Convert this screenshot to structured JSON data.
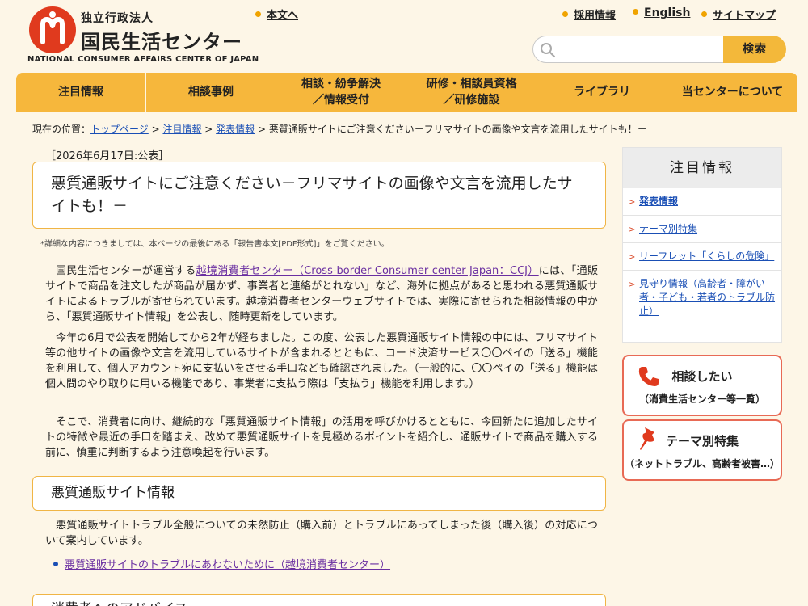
{
  "header": {
    "logo_sub": "独立行政法人",
    "logo_main": "国民生活センター",
    "logo_en": "NATIONAL CONSUMER AFFAIRS CENTER OF JAPAN",
    "links": {
      "honbun": "本文へ",
      "saiyo": "採用情報",
      "english": "English",
      "sitemap": "サイトマップ"
    },
    "search": {
      "placeholder": "",
      "button": "検索"
    }
  },
  "nav": {
    "items": [
      {
        "line1": "注目情報",
        "line2": ""
      },
      {
        "line1": "相談事例",
        "line2": ""
      },
      {
        "line1": "相談・紛争解決",
        "line2": "／情報受付"
      },
      {
        "line1": "研修・相談員資格",
        "line2": "／研修施設"
      },
      {
        "line1": "ライブラリ",
        "line2": ""
      },
      {
        "line1": "当センターについて",
        "line2": ""
      }
    ]
  },
  "breadcrumb": {
    "prefix": "現在の位置：",
    "links": [
      "トップページ",
      "注目情報",
      "発表情報"
    ],
    "sep": " > ",
    "current": "悪質通販サイトにご注意ください－フリマサイトの画像や文言を流用したサイトも！－"
  },
  "article": {
    "date": "［2026年6月17日:公表］",
    "title": "悪質通販サイトにご注意ください－フリマサイトの画像や文言を流用したサイトも！－",
    "note": "*詳細な内容につきましては、本ページの最後にある「報告書本文[PDF形式]」をご覧ください。",
    "p1_before": "国民生活センターが運営する",
    "p1_link": "越境消費者センター（Cross-border Consumer center Japan：CCJ）",
    "p1_after": "には、「通販サイトで商品を注文したが商品が届かず、事業者と連絡がとれない」など、海外に拠点があると思われる悪質通販サイトによるトラブルが寄せられています。越境消費者センターウェブサイトでは、実際に寄せられた相談情報の中から、「悪質通販サイト情報」を公表し、随時更新をしています。",
    "p2": "今年の6月で公表を開始してから2年が経ちました。この度、公表した悪質通販サイト情報の中には、フリマサイト等の他サイトの画像や文言を流用しているサイトが含まれるとともに、コード決済サービス〇〇ペイの「送る」機能を利用して、個人アカウント宛に支払いをさせる手口なども確認されました。（一般的に、〇〇ペイの「送る」機能は個人間のやり取りに用いる機能であり、事業者に支払う際は「支払う」機能を利用します。）",
    "p3": "そこで、消費者に向け、継続的な「悪質通販サイト情報」の活用を呼びかけるとともに、今回新たに追加したサイトの特徴や最近の手口を踏まえ、改めて悪質通販サイトを見極めるポイントを紹介し、通販サイトで商品を購入する前に、慎重に判断するよう注意喚起を行います。",
    "section1_title": "悪質通販サイト情報",
    "p4": "悪質通販サイトトラブル全般についての未然防止（購入前）とトラブルにあってしまった後（購入後）の対応について案内しています。",
    "bullet1": "悪質通販サイトのトラブルにあわないために（越境消費者センター）",
    "section2_title": "消費者へのアドバイス"
  },
  "sidebar": {
    "heading": "注目情報",
    "items": [
      "発表情報",
      "テーマ別特集",
      "リーフレット「くらしの危険」",
      "見守り情報（高齢者・障がい者・子ども・若者のトラブル防止）"
    ],
    "btn_soudan": {
      "main": "相談したい",
      "sub": "（消費生活センター等一覧）"
    },
    "btn_theme": {
      "main": "テーマ別特集",
      "sub": "（ネットトラブル、高齢者被害…）"
    }
  },
  "colors": {
    "accent": "#f6b73c",
    "logo_red": "#e03a1e",
    "link_blue": "#1a4fb5",
    "visited_purple": "#6a2fa1",
    "box_border": "#f0b545",
    "button_border": "#e86a55"
  }
}
